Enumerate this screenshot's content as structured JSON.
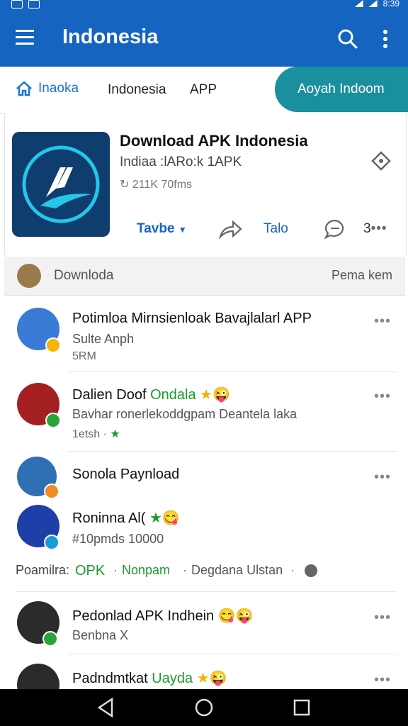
{
  "status_bar": {
    "time": "8:39"
  },
  "app_bar": {
    "title": "Indonesia"
  },
  "tabs": {
    "home": "Inaoka",
    "items": [
      "Indonesia",
      "APP"
    ],
    "pill": "Aoyah Indoom"
  },
  "app_card": {
    "title": "Download APK Indonesia",
    "subtitle": "Indiaa :lARo:k 1APK",
    "meta": "211K 70fms",
    "actions": {
      "follow": "Tavbe",
      "label": "Talo",
      "count": "3"
    }
  },
  "section": {
    "title": "Downloda",
    "link": "Pema kem"
  },
  "items": [
    {
      "title": "Potimloa Mirnsienloak Bavajlalarl APP",
      "sub": "Sulte Anph",
      "meta": "5RM"
    },
    {
      "title": "Dalien Doof",
      "title_green": "Ondala",
      "sub": "Bavhar ronerlekoddgpam Deantela laka",
      "meta": "1etsh ·"
    },
    {
      "title": "Sonola Paynload"
    },
    {
      "title": "Roninna Al(",
      "sub": "#10pmds 10000"
    },
    {
      "title": "Pedonlad APK Indhein",
      "sub": "Benbna X"
    },
    {
      "title": "Padndmtkat",
      "title_green": "Uayda"
    }
  ],
  "footer_line": {
    "lead": "Poamilra:",
    "green1": "OPK",
    "green2": "Nonpam",
    "tail": "Degdana Ulstan"
  },
  "colors": {
    "primary": "#1565c0",
    "accent": "#1a8f9e",
    "green": "#1c9a2e"
  }
}
